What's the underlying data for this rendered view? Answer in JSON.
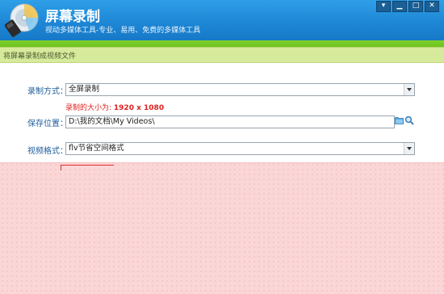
{
  "window": {
    "title": "屏幕录制",
    "subtitle": "视动多媒体工具-专业、易用、免费的多媒体工具",
    "controls": [
      "menu",
      "minimize",
      "maximize",
      "close"
    ]
  },
  "toolbar": {
    "section_label": "将屏幕录制成视频文件"
  },
  "form": {
    "record_mode": {
      "label": "录制方式：",
      "value": "全屏录制"
    },
    "record_size": {
      "prefix": "录制的大小为: ",
      "value": "1920 x 1080"
    },
    "save_location": {
      "label": "保存位置：",
      "value": "D:\\我的文档\\My Videos\\"
    },
    "video_format": {
      "label": "视频格式：",
      "value": "flv节省空间格式"
    }
  },
  "colors": {
    "title_blue": "#1e87d6",
    "green_bar": "#5fb715",
    "label_blue": "#1f5e9c",
    "note_red": "#e02020",
    "pink_area": "#fbd6d6"
  }
}
